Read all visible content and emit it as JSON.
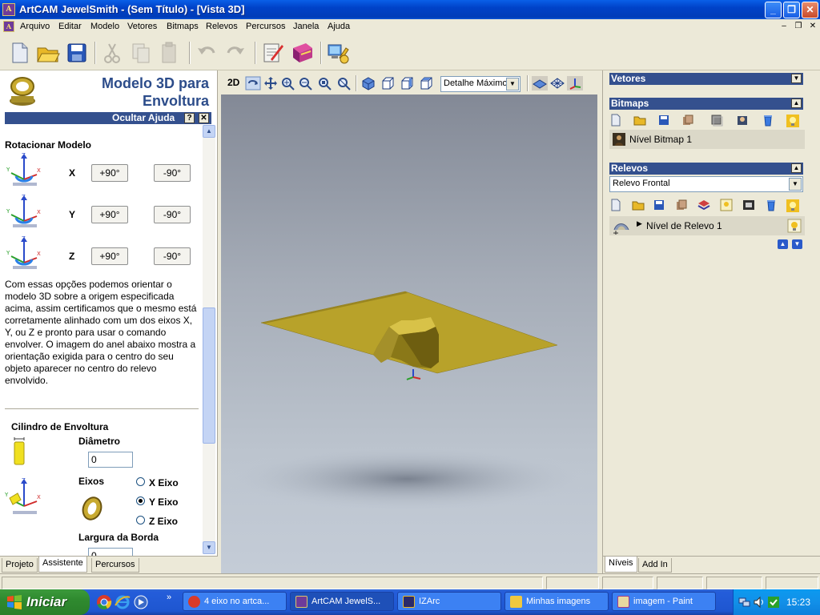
{
  "window": {
    "title": "ArtCAM JewelSmith - (Sem Título) - [Vista 3D]",
    "app_icon": "artcam-icon"
  },
  "menu": [
    "Arquivo",
    "Editar",
    "Modelo",
    "Vetores",
    "Bitmaps",
    "Relevos",
    "Percursos",
    "Janela",
    "Ajuda"
  ],
  "left": {
    "title_line1": "Modelo 3D para",
    "title_line2": "Envoltura",
    "help_bar": "Ocultar Ajuda",
    "help_q": "?",
    "help_x": "✕",
    "rotate_heading": "Rotacionar Modelo",
    "axes": [
      {
        "label": "X",
        "plus": "+90°",
        "minus": "-90°"
      },
      {
        "label": "Y",
        "plus": "+90°",
        "minus": "-90°"
      },
      {
        "label": "Z",
        "plus": "+90°",
        "minus": "-90°"
      }
    ],
    "paragraph": "Com essas opções podemos orientar o modelo 3D sobre a origem especificada acima, assim certificamos que o mesmo está corretamente alinhado com um dos eixos X, Y, ou Z e pronto para usar o comando envolver. O imagem do anel abaixo mostra a orientação exigida para o centro do seu objeto aparecer no centro do relevo envolvido.",
    "cylinder_heading": "Cilindro de Envoltura",
    "diameter_label": "Diâmetro",
    "diameter_value": "0",
    "axes_label": "Eixos",
    "axis_options": [
      {
        "label": "X Eixo",
        "selected": false
      },
      {
        "label": "Y Eixo",
        "selected": true
      },
      {
        "label": "Z Eixo",
        "selected": false
      }
    ],
    "border_width_label": "Largura da Borda",
    "border_width_value": "0",
    "tabs": [
      "Projeto",
      "Assistente",
      "Percursos"
    ],
    "active_tab": "Assistente"
  },
  "view": {
    "mode_2d": "2D",
    "detail_select": "Detalhe Máximo",
    "model_color": "#B8A22A",
    "background_top": "#838996",
    "background_bottom": "#C4CCD7"
  },
  "right": {
    "vectors_title": "Vetores",
    "bitmaps_title": "Bitmaps",
    "bitmap_layer": "Nível Bitmap 1",
    "reliefs_title": "Relevos",
    "relief_select": "Relevo Frontal",
    "relief_layer": "Nível de Relevo 1",
    "tabs": [
      "Níveis",
      "Add In"
    ],
    "active_tab": "Níveis"
  },
  "taskbar": {
    "start": "Iniciar",
    "tasks": [
      {
        "label": "4 eixo no artca...",
        "icon": "chrome-icon",
        "active": false
      },
      {
        "label": "ArtCAM JewelS...",
        "icon": "artcam-icon",
        "active": true
      },
      {
        "label": "IZArc",
        "icon": "izarc-icon",
        "active": false
      },
      {
        "label": "Minhas imagens",
        "icon": "folder-icon",
        "active": false
      },
      {
        "label": "imagem - Paint",
        "icon": "paint-icon",
        "active": false
      }
    ],
    "clock": "15:23"
  }
}
